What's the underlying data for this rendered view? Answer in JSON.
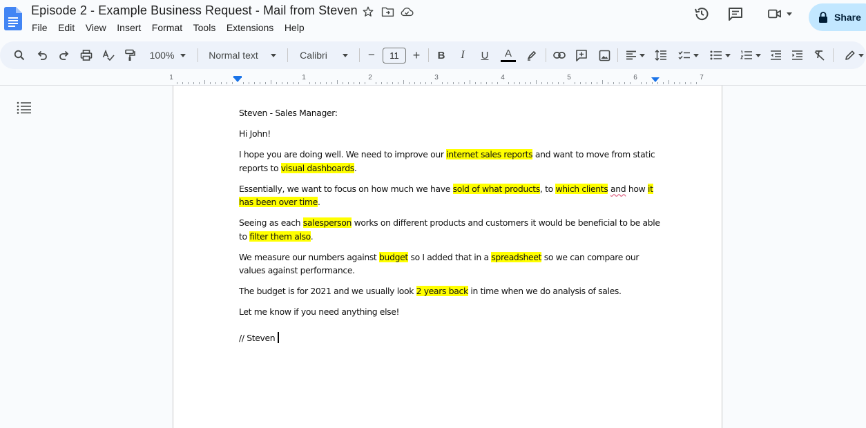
{
  "app": {
    "doc_title": "Episode 2 - Example Business Request - Mail from Steven",
    "share_label": "Share"
  },
  "menu": [
    "File",
    "Edit",
    "View",
    "Insert",
    "Format",
    "Tools",
    "Extensions",
    "Help"
  ],
  "toolbar": {
    "zoom": "100%",
    "style": "Normal text",
    "font": "Calibri",
    "font_size": "11",
    "minus": "−",
    "plus": "+",
    "bold": "B",
    "italic": "I",
    "underline": "U",
    "text_color": "A"
  },
  "ruler": {
    "labels": [
      "1",
      "1",
      "2",
      "3",
      "4",
      "5",
      "6",
      "7"
    ]
  },
  "document": {
    "p1": "Steven  - Sales Manager:",
    "p2": "Hi John!",
    "p3": [
      "I hope you are doing well. We need to improve our ",
      "internet sales reports",
      " and want to move from static reports to ",
      "visual dashboards",
      "."
    ],
    "p4": [
      "Essentially, we want to focus on how much we have ",
      "sold of what products",
      ", to ",
      "which clients",
      " ",
      "and",
      " how ",
      "it has been over time",
      "."
    ],
    "p5": [
      "Seeing as each ",
      "salesperson",
      " works on different products and customers it would be beneficial to be able to ",
      "filter them also",
      "."
    ],
    "p6": [
      "We measure our numbers against ",
      "budget",
      " so I added that in a ",
      "spreadsheet",
      " so we can compare our values against performance."
    ],
    "p7": [
      "The budget is for 2021 and we usually look ",
      "2 years back",
      " in time when we do analysis of sales."
    ],
    "p8": "Let me know if you need anything else!",
    "p9": "// Steven"
  },
  "colors": {
    "highlight": "#ffff00",
    "share_bg": "#c2e7ff",
    "toolbar_bg": "#edf2fa",
    "accent": "#1a73e8"
  }
}
